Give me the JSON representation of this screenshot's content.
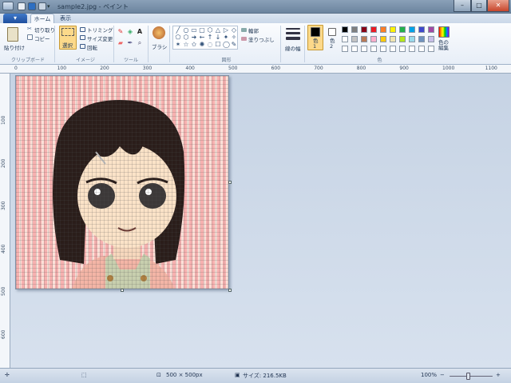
{
  "window": {
    "title": "sample2.jpg - ペイント",
    "minimize": "–",
    "maximize": "□",
    "close": "✕"
  },
  "tabs": {
    "file": "▾",
    "home": "ホーム",
    "view": "表示"
  },
  "ribbon": {
    "clipboard": {
      "paste": "貼り付け",
      "cut": "切り取り",
      "copy": "コピー",
      "label": "クリップボード"
    },
    "image": {
      "select": "選択",
      "crop": "トリミング",
      "resize": "サイズ変更",
      "rotate": "回転",
      "label": "イメージ"
    },
    "tools": {
      "label": "ツール"
    },
    "brush": {
      "label": "ブラシ"
    },
    "shapes": {
      "outline": "輪郭",
      "fill": "塗りつぶし",
      "label": "図形",
      "glyphs": [
        "╱",
        "○",
        "▭",
        "▢",
        "⬡",
        "△",
        "▷",
        "◇",
        "⬠",
        "⬡",
        "➜",
        "←",
        "↑",
        "↓",
        "✦",
        "✧",
        "✶",
        "☆",
        "✩",
        "✺",
        "◌",
        "☐",
        "◯",
        "✎"
      ]
    },
    "size": {
      "label": "線の幅"
    },
    "colors": {
      "color1": "色\n1",
      "color2": "色\n2",
      "edit": "色の\n編集",
      "label": "色",
      "palette": [
        "#000000",
        "#7f7f7f",
        "#880015",
        "#ed1c24",
        "#ff7f27",
        "#fff200",
        "#22b14c",
        "#00a2e8",
        "#3f48cc",
        "#a349a4",
        "#ffffff",
        "#c3c3c3",
        "#b97a57",
        "#ffaec9",
        "#ffc90e",
        "#efe4b0",
        "#b5e61d",
        "#99d9ea",
        "#7092be",
        "#c8bfe7",
        "#ffffff",
        "#ffffff",
        "#ffffff",
        "#ffffff",
        "#ffffff",
        "#ffffff",
        "#ffffff",
        "#ffffff",
        "#ffffff",
        "#ffffff"
      ],
      "color1_value": "#000000",
      "color2_value": "#ffffff"
    }
  },
  "ruler": {
    "h": [
      "0",
      "100",
      "200",
      "300",
      "400",
      "500",
      "600",
      "700",
      "800",
      "900",
      "1000",
      "1100"
    ],
    "v": [
      "100",
      "200",
      "300",
      "400",
      "500",
      "600"
    ]
  },
  "status": {
    "dimensions": "500 × 500px",
    "size": "サイズ: 216.5KB",
    "zoom": "100%",
    "zoom_out": "−",
    "zoom_in": "+"
  }
}
